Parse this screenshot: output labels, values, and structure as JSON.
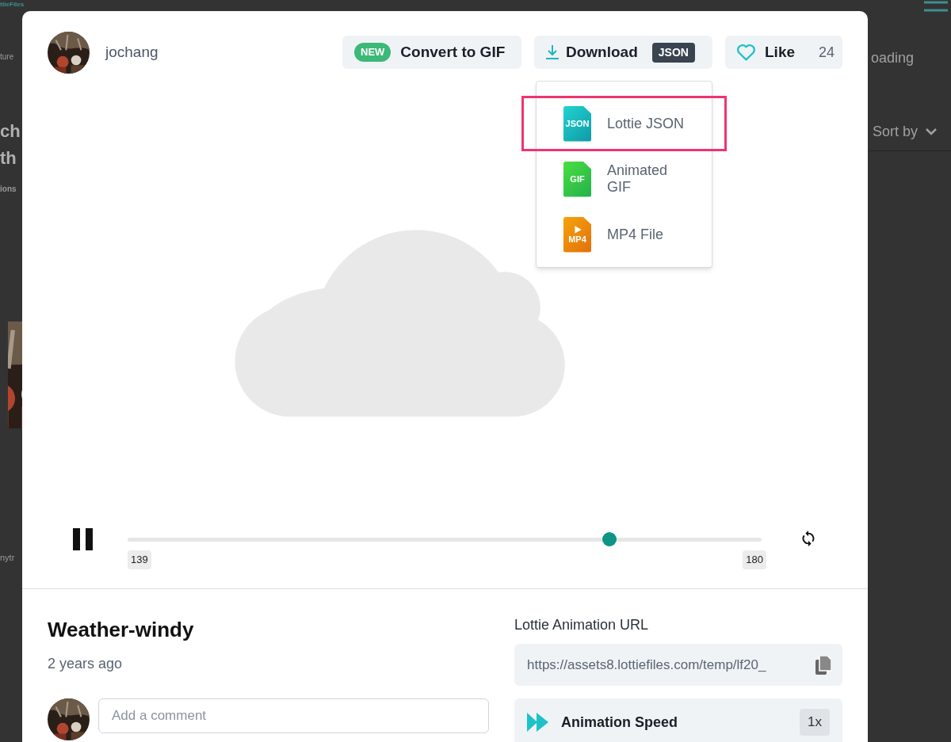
{
  "background_page": {
    "logo": "ttieFiles",
    "left_fragments": [
      "ture",
      "ch",
      "th",
      "ions",
      "nytr"
    ],
    "status": "oading",
    "sort": "Sort by"
  },
  "modal": {
    "author": {
      "name": "jochang"
    },
    "convert_button": {
      "badge": "NEW",
      "label": "Convert to GIF"
    },
    "download_button": {
      "label": "Download",
      "format": "JSON"
    },
    "like_button": {
      "label": "Like",
      "count": "24",
      "liked": false
    },
    "download_menu": {
      "expanded": true,
      "items": [
        {
          "kind": "json",
          "icon_text": "JSON",
          "label": "Lottie JSON",
          "selected": true
        },
        {
          "kind": "gif",
          "icon_text": "GIF",
          "label": "Animated GIF",
          "selected": false
        },
        {
          "kind": "mp4",
          "icon_text": "MP4",
          "label": "MP4 File",
          "selected": false
        }
      ]
    },
    "player": {
      "playing": true,
      "level": 0.76,
      "start": "139",
      "end": "180"
    },
    "title": "Weather-windy",
    "age": "2 years ago",
    "comment": {
      "placeholder": "Add a comment"
    },
    "url": {
      "label": "Lottie Animation URL",
      "value": "https://assets8.lottiefiles.com/temp/lf20_"
    },
    "speed": {
      "label": "Animation Speed",
      "value": "1x"
    }
  }
}
